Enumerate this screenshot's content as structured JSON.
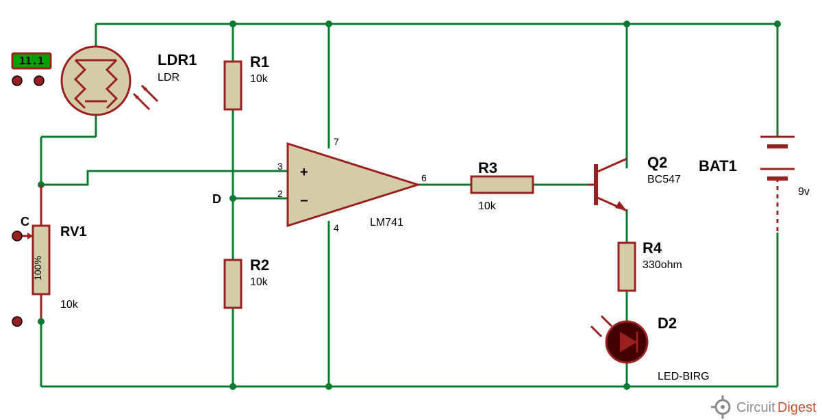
{
  "lcd": {
    "value": "11.1"
  },
  "nets": {
    "C": "C",
    "D": "D"
  },
  "components": {
    "ldr": {
      "ref": "LDR1",
      "value": "LDR"
    },
    "r1": {
      "ref": "R1",
      "value": "10k"
    },
    "r2": {
      "ref": "R2",
      "value": "10k"
    },
    "r3": {
      "ref": "R3",
      "value": "10k"
    },
    "r4": {
      "ref": "R4",
      "value": "330ohm"
    },
    "rv1": {
      "ref": "RV1",
      "value": "10k",
      "wiper": "100%"
    },
    "opamp": {
      "ref": "LM741",
      "pins": {
        "nin": "3",
        "inv": "2",
        "out": "6",
        "vp": "7",
        "vn": "4"
      },
      "plus": "+",
      "minus": "−"
    },
    "q2": {
      "ref": "Q2",
      "value": "BC547"
    },
    "d2": {
      "ref": "D2",
      "value": "LED-BIRG"
    },
    "bat": {
      "ref": "BAT1",
      "value": "9v"
    }
  },
  "watermark": {
    "brand": "Circuit",
    "accent": "Digest"
  }
}
